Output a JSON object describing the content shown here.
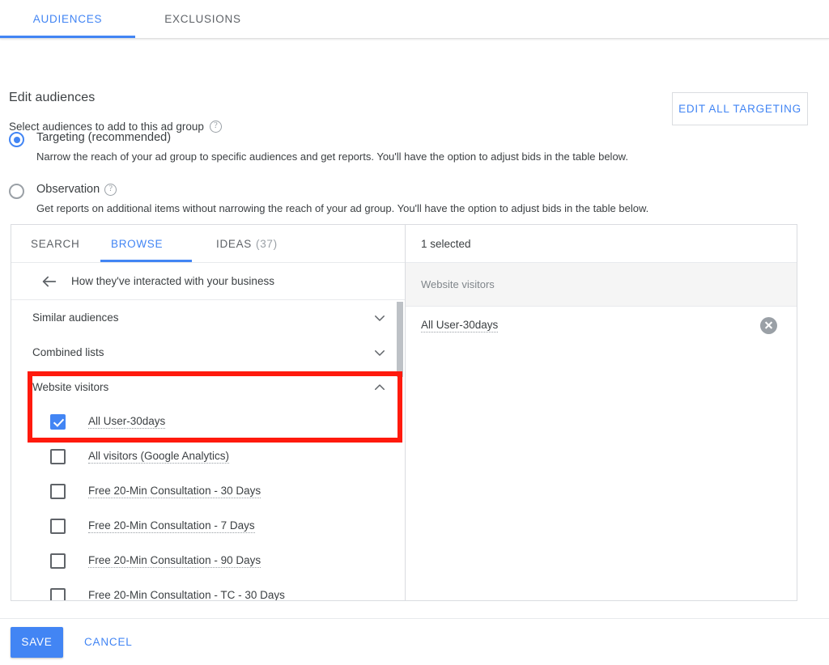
{
  "top_tabs": [
    {
      "label": "AUDIENCES",
      "active": true
    },
    {
      "label": "EXCLUSIONS",
      "active": false
    }
  ],
  "header": {
    "title": "Edit audiences",
    "subtitle": "Select audiences to add to this ad group",
    "help_icon": "help-circle-icon",
    "edit_all_label": "EDIT ALL TARGETING"
  },
  "modes": [
    {
      "label": "Targeting (recommended)",
      "description": "Narrow the reach of your ad group to specific audiences and get reports. You'll have the option to adjust bids in the table below.",
      "selected": true,
      "has_help": false
    },
    {
      "label": "Observation",
      "description": "Get reports on additional items without narrowing the reach of your ad group. You'll have the option to adjust bids in the table below.",
      "selected": false,
      "has_help": true
    }
  ],
  "picker": {
    "tabs": [
      {
        "label": "SEARCH",
        "count": "",
        "active": false
      },
      {
        "label": "BROWSE",
        "count": "",
        "active": true
      },
      {
        "label": "IDEAS",
        "count": "(37)",
        "active": false
      }
    ],
    "breadcrumb": {
      "back_icon": "arrow-left-icon",
      "text": "How they've interacted with your business"
    },
    "groups": [
      {
        "label": "Similar audiences",
        "expanded": false,
        "chevron": "chevron-down-icon"
      },
      {
        "label": "Combined lists",
        "expanded": false,
        "chevron": "chevron-down-icon"
      },
      {
        "label": "Website visitors",
        "expanded": true,
        "chevron": "chevron-up-icon"
      }
    ],
    "items": [
      {
        "label": "All User-30days",
        "checked": true
      },
      {
        "label": "All visitors (Google Analytics)",
        "checked": false
      },
      {
        "label": "Free 20-Min Consultation - 30 Days",
        "checked": false
      },
      {
        "label": "Free 20-Min Consultation - 7 Days",
        "checked": false
      },
      {
        "label": "Free 20-Min Consultation - 90 Days",
        "checked": false
      },
      {
        "label": "Free 20-Min Consultation - TC - 30 Days",
        "checked": false
      }
    ]
  },
  "selection": {
    "summary": "1 selected",
    "group_label": "Website visitors",
    "items": [
      {
        "label": "All User-30days",
        "remove_icon": "close-circle-icon"
      }
    ]
  },
  "footer": {
    "save_label": "SAVE",
    "cancel_label": "CANCEL"
  },
  "colors": {
    "accent": "#4285f4",
    "highlight": "#ff1a0d",
    "text": "#3c4043",
    "muted": "#80868b"
  }
}
